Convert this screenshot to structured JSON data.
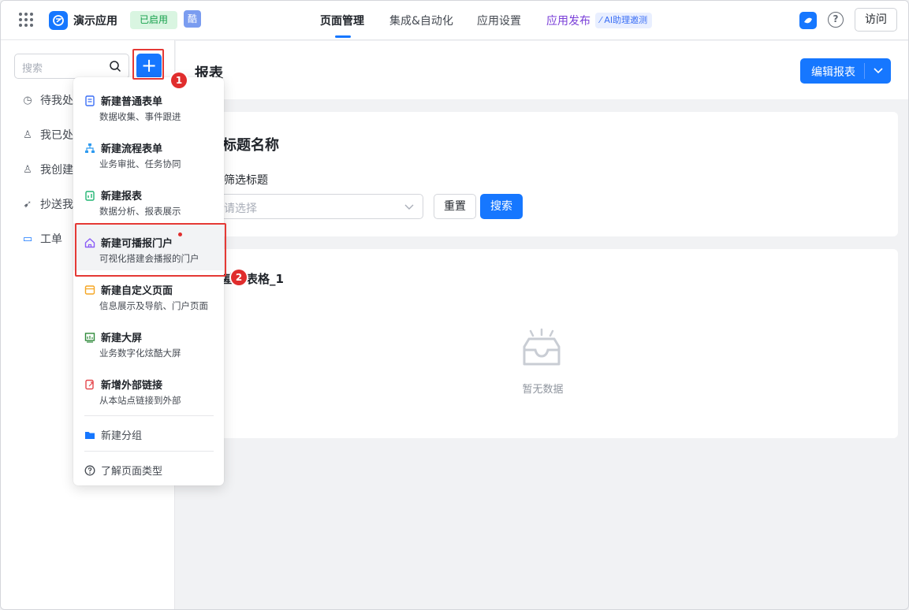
{
  "topbar": {
    "app_name": "演示应用",
    "status_badge": "已启用",
    "ku_badge": "酷",
    "tabs": [
      {
        "label": "页面管理",
        "active": true
      },
      {
        "label": "集成&自动化"
      },
      {
        "label": "应用设置"
      }
    ],
    "publish_label": "应用发布",
    "ai_pill": "AI助理邀测",
    "help_glyph": "?",
    "visit_label": "访问"
  },
  "sidebar": {
    "search_placeholder": "搜索",
    "add_glyph": "+",
    "items": [
      {
        "label": "待我处理",
        "icon": "clock-icon"
      },
      {
        "label": "我已处理",
        "icon": "user-check-icon"
      },
      {
        "label": "我创建的",
        "icon": "user-plus-icon"
      },
      {
        "label": "抄送我的",
        "icon": "send-icon"
      },
      {
        "label": "工单",
        "icon": "folder-icon"
      }
    ]
  },
  "annotations": {
    "badge1": "1",
    "badge2": "2"
  },
  "main": {
    "page_title": "报表",
    "edit_button": "编辑报表",
    "filter_card": {
      "title": "标题名称",
      "field_label": "筛选标题",
      "select_placeholder": "请选择",
      "reset": "重置",
      "search": "搜索"
    },
    "table_card": {
      "title": "基础表格_1",
      "empty_text": "暂无数据"
    }
  },
  "dropdown": {
    "items": [
      {
        "title": "新建普通表单",
        "subtitle": "数据收集、事件跟进",
        "icon": "form-icon",
        "color": "#3b6ff5"
      },
      {
        "title": "新建流程表单",
        "subtitle": "业务审批、任务协同",
        "icon": "flow-icon",
        "color": "#2f9bf0"
      },
      {
        "title": "新建报表",
        "subtitle": "数据分析、报表展示",
        "icon": "report-icon",
        "color": "#22b573"
      },
      {
        "title": "新建可播报门户",
        "subtitle": "可视化搭建会播报的门户",
        "icon": "home-icon",
        "color": "#8b5cf6"
      },
      {
        "title": "新建自定义页面",
        "subtitle": "信息展示及导航、门户页面",
        "icon": "page-icon",
        "color": "#f5a623"
      },
      {
        "title": "新建大屏",
        "subtitle": "业务数字化炫酷大屏",
        "icon": "screen-icon",
        "color": "#2f8a3a"
      },
      {
        "title": "新增外部链接",
        "subtitle": "从本站点链接到外部",
        "icon": "link-icon",
        "color": "#e5484d"
      }
    ],
    "new_group": "新建分组",
    "learn_types": "了解页面类型"
  }
}
